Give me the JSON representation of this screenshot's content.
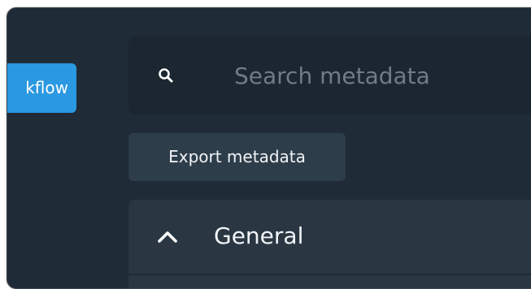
{
  "toolbar": {
    "workflow_label": "kflow",
    "export_label": "Export metadata"
  },
  "search": {
    "placeholder": "Search metadata",
    "value": "",
    "icon": "search-icon"
  },
  "sections": [
    {
      "title": "General",
      "icon": "chevron-up-icon",
      "expanded": true
    }
  ],
  "colors": {
    "background": "#1f2b36",
    "accent": "#2b98e2",
    "panel": "#2a3743",
    "search_bg": "#1b2630",
    "button_bg": "#2e3d4a"
  }
}
